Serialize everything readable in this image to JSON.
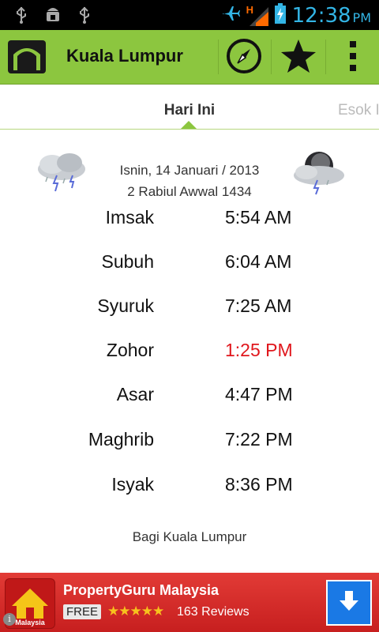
{
  "status_bar": {
    "time": "12:38",
    "ampm": "PM",
    "network_label": "H",
    "icons": [
      "usb-icon",
      "android-debug-icon",
      "usb-icon",
      "airplane-icon",
      "signal-icon",
      "battery-charging-icon"
    ]
  },
  "action_bar": {
    "title": "Kuala Lumpur",
    "icons": [
      "mosque-logo-icon",
      "compass-icon",
      "star-icon",
      "overflow-menu-icon"
    ],
    "accent_color": "#8cc63f"
  },
  "tabs": {
    "active": "Hari Ini",
    "next": "Esok I"
  },
  "date": {
    "gregorian": "Isnin, 14 Januari / 2013",
    "hijri": "2 Rabiul Awwal 1434",
    "weather_icons": [
      "storm-cloud-icon",
      "night-storm-icon"
    ]
  },
  "prayers": [
    {
      "name": "Imsak",
      "time": "5:54 AM",
      "current": false
    },
    {
      "name": "Subuh",
      "time": "6:04 AM",
      "current": false
    },
    {
      "name": "Syuruk",
      "time": "7:25 AM",
      "current": false
    },
    {
      "name": "Zohor",
      "time": "1:25 PM",
      "current": true
    },
    {
      "name": "Asar",
      "time": "4:47 PM",
      "current": false
    },
    {
      "name": "Maghrib",
      "time": "7:22 PM",
      "current": false
    },
    {
      "name": "Isyak",
      "time": "8:36 PM",
      "current": false
    }
  ],
  "footer": "Bagi Kuala Lumpur",
  "ad": {
    "title": "PropertyGuru Malaysia",
    "free_label": "FREE",
    "stars": "★★★★★",
    "rating": 4.5,
    "reviews": "163 Reviews",
    "icon_label": "Malaysia",
    "info": "i",
    "download_icon": "download-arrow-icon"
  }
}
